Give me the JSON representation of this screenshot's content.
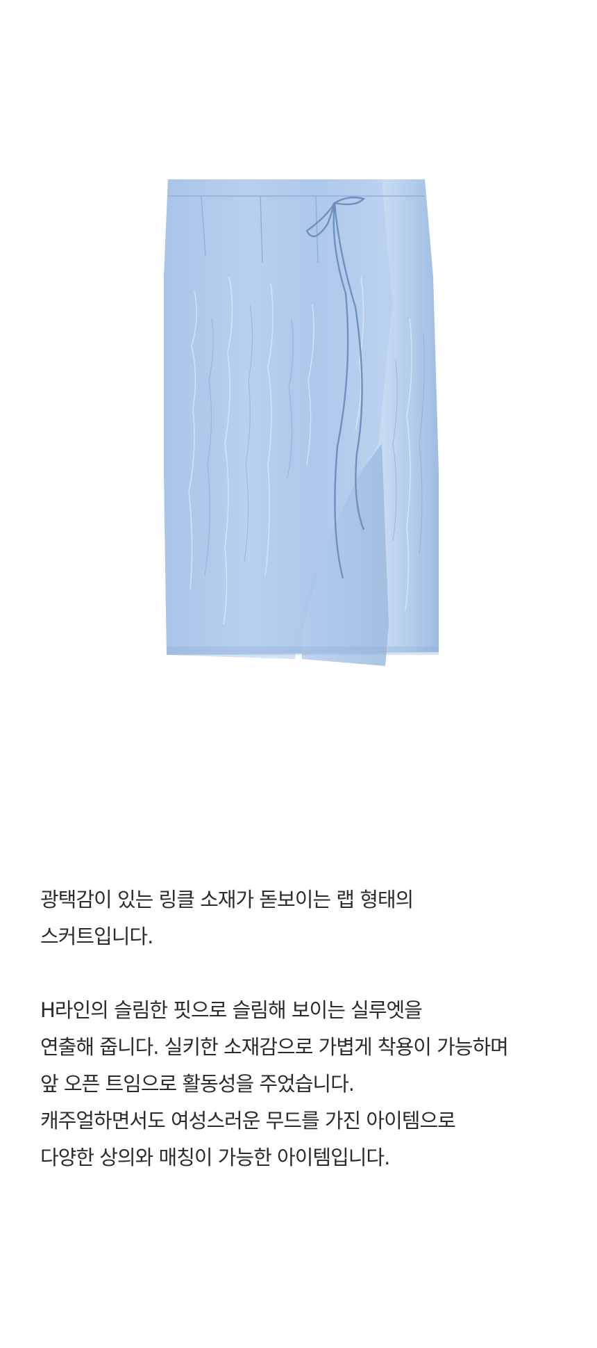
{
  "product": {
    "image_alt": "blue wrap skirt",
    "colors": {
      "fabric_main": "#a6c4e6",
      "fabric_light": "#c7dbf2",
      "fabric_shadow": "#7d9fca",
      "tie": "#6f8fbc"
    }
  },
  "description": {
    "paragraph1": [
      "광택감이 있는 링클 소재가 돋보이는 랩 형태의",
      "스커트입니다."
    ],
    "paragraph2": [
      "H라인의 슬림한 핏으로 슬림해 보이는 실루엣을",
      "연출해 줍니다. 실키한 소재감으로 가볍게 착용이 가능하며",
      "앞 오픈 트임으로 활동성을 주었습니다.",
      "캐주얼하면서도 여성스러운 무드를 가진 아이템으로",
      "다양한 상의와 매칭이 가능한 아이템입니다."
    ]
  }
}
